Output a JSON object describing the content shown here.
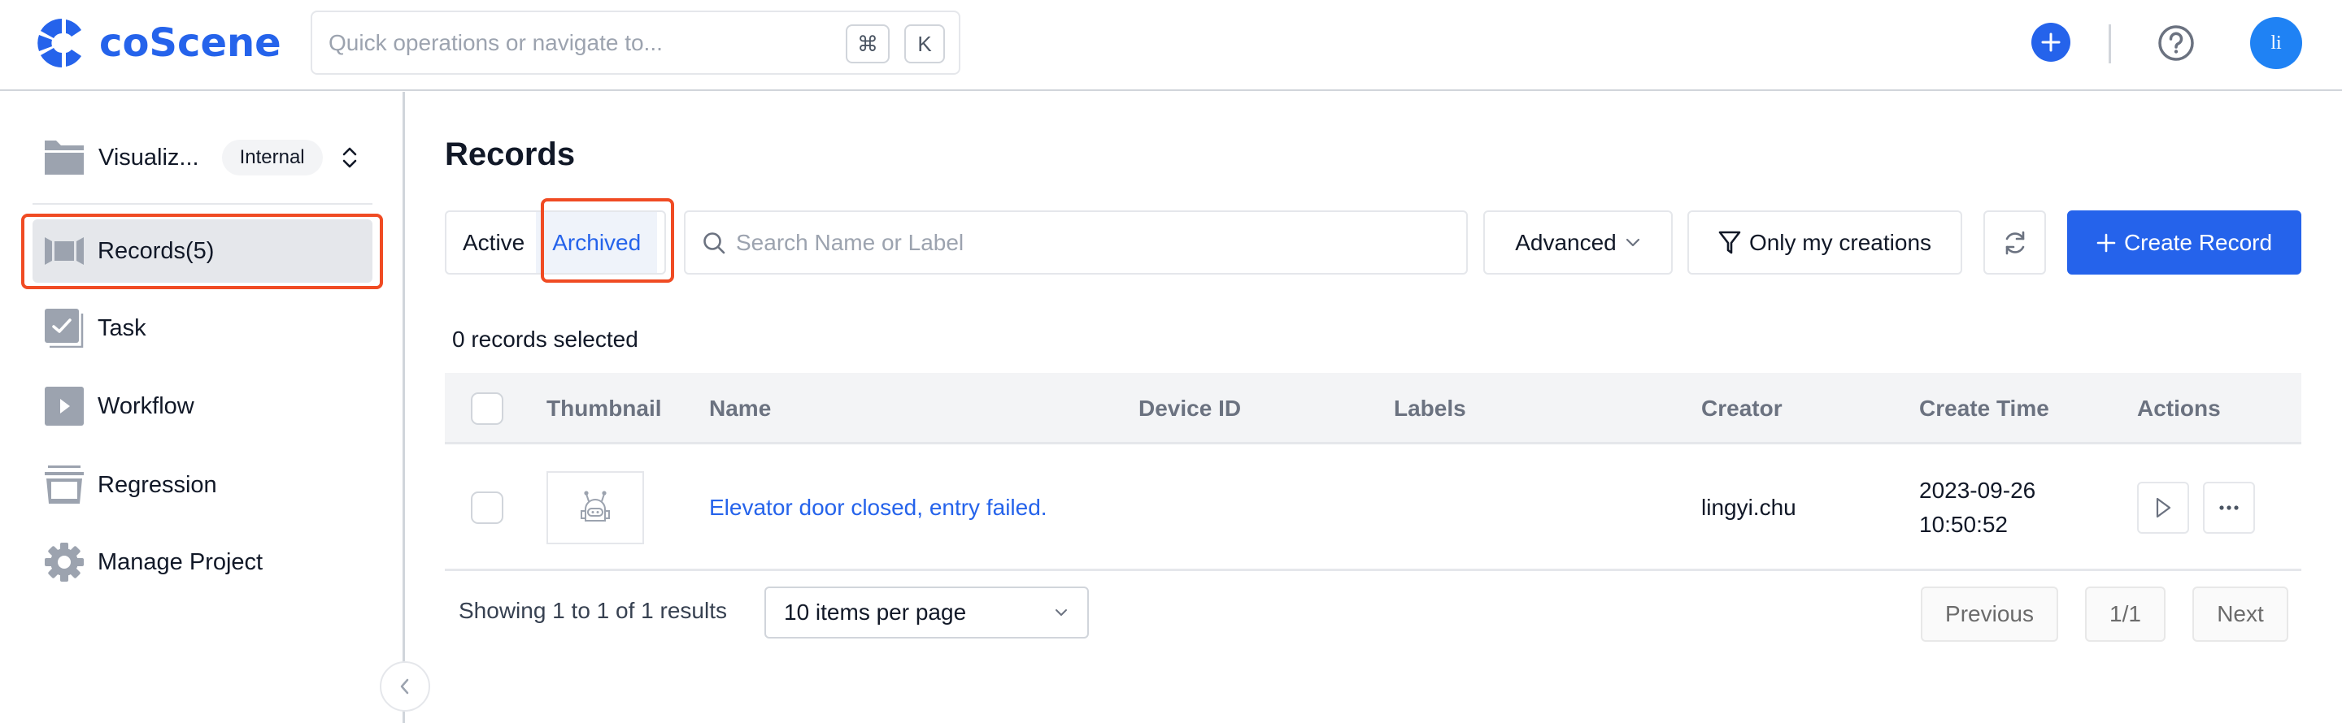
{
  "header": {
    "brand": "coScene",
    "quick_search_placeholder": "Quick operations or navigate to...",
    "shortcut_keys": [
      "⌘",
      "K"
    ],
    "avatar_initials": "li",
    "brand_color": "#2563eb",
    "avatar_color": "#1f82f4"
  },
  "sidebar": {
    "project_name": "Visualiz...",
    "project_badge": "Internal",
    "items": [
      {
        "label": "Records(5)",
        "icon": "records-icon",
        "active": true
      },
      {
        "label": "Task",
        "icon": "task-icon",
        "active": false
      },
      {
        "label": "Workflow",
        "icon": "workflow-icon",
        "active": false
      },
      {
        "label": "Regression",
        "icon": "regression-icon",
        "active": false
      },
      {
        "label": "Manage Project",
        "icon": "gear-icon",
        "active": false
      }
    ]
  },
  "main": {
    "title": "Records",
    "tabs": [
      {
        "label": "Active",
        "active": false
      },
      {
        "label": "Archived",
        "active": true
      }
    ],
    "search_placeholder": "Search Name or Label",
    "advanced_label": "Advanced",
    "only_mine_label": "Only my creations",
    "create_label": "Create Record",
    "selection_text": "0 records selected",
    "table": {
      "columns": [
        "Thumbnail",
        "Name",
        "Device ID",
        "Labels",
        "Creator",
        "Create Time",
        "Actions"
      ],
      "rows": [
        {
          "name": "Elevator door closed, entry failed.",
          "device_id": "",
          "labels": "",
          "creator": "lingyi.chu",
          "create_date": "2023-09-26",
          "create_time": "10:50:52"
        }
      ]
    },
    "footer": {
      "showing": "Showing 1 to 1 of 1 results",
      "per_page": "10 items per page",
      "previous": "Previous",
      "page": "1/1",
      "next": "Next"
    }
  },
  "highlight_color": "#f04b23"
}
